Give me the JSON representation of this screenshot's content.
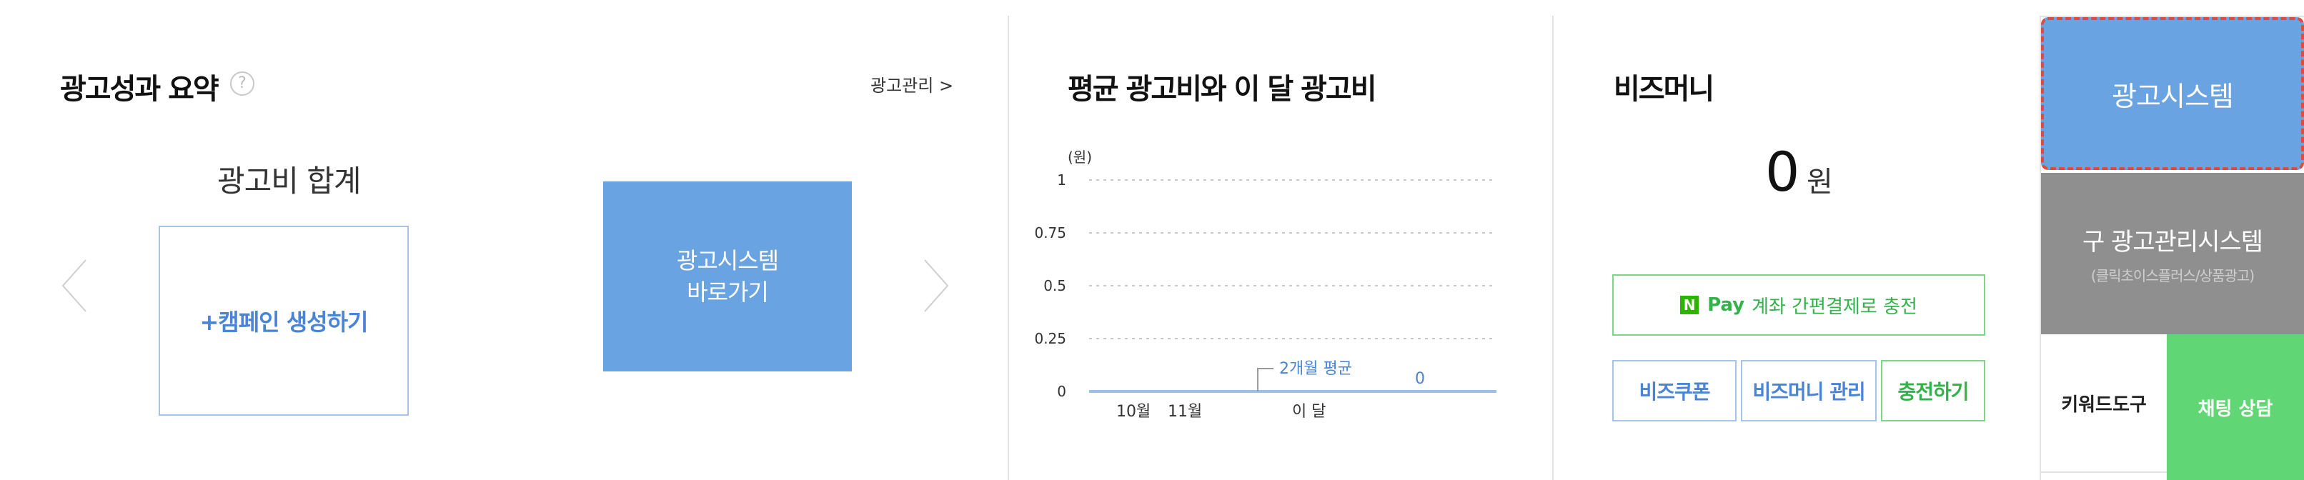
{
  "summary": {
    "title": "광고성과 요약",
    "help_icon": "question-circle-icon",
    "manage_link": "광고관리 >",
    "total_label": "광고비 합계",
    "create_campaign": "+캠페인 생성하기",
    "adsys_line1": "광고시스템",
    "adsys_line2": "바로가기"
  },
  "avg_cost": {
    "title": "평균 광고비와 이 달 광고비",
    "unit": "(원)",
    "annotation": "2개월 평균",
    "value_label": "0",
    "chart_data": {
      "type": "line",
      "categories": [
        "10월",
        "11월",
        "이 달"
      ],
      "series": [
        {
          "values": [
            0,
            0,
            0
          ]
        }
      ],
      "y_ticks": [
        "1",
        "0.75",
        "0.5",
        "0.25",
        "0"
      ],
      "ylim": [
        0,
        1
      ],
      "ylabel": "(원)",
      "grid": true
    }
  },
  "bizmoney": {
    "title": "비즈머니",
    "amount": "0",
    "unit": "원",
    "pay_logo": "N",
    "pay_word": "Pay",
    "pay_text": "계좌 간편결제로 충전",
    "coupon": "비즈쿠폰",
    "manage": "비즈머니 관리",
    "charge": "충전하기"
  },
  "side": {
    "adsys": "광고시스템",
    "old_main": "구 광고관리시스템",
    "old_sub": "(클릭초이스플러스/상품광고)",
    "keyword_tool": "키워드도구",
    "chat": "채팅 상담"
  },
  "colors": {
    "accent_blue": "#6aa3e2",
    "link_blue": "#4a84d5",
    "green": "#33b24a",
    "chat_green": "#60d774",
    "gray": "#8f8f8f",
    "highlight_red": "#e24a3d"
  }
}
